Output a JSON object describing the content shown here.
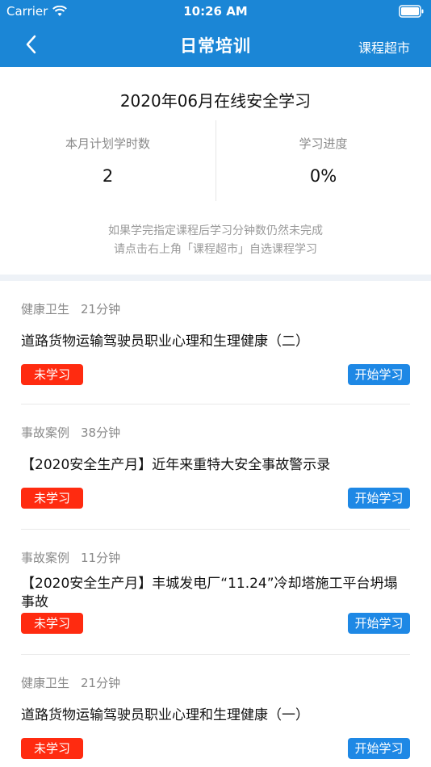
{
  "status_bar": {
    "carrier": "Carrier",
    "time": "10:26 AM"
  },
  "nav": {
    "title": "日常培训",
    "right_link": "课程超市"
  },
  "summary": {
    "plan_title": "2020年06月在线安全学习",
    "planned_hours_label": "本月计划学时数",
    "planned_hours_value": "2",
    "progress_label": "学习进度",
    "progress_value": "0%",
    "hint_line1": "如果学完指定课程后学习分钟数仍然未完成",
    "hint_line2": "请点击右上角「课程超市」自选课程学习"
  },
  "courses": [
    {
      "category": "健康卫生",
      "duration": "21分钟",
      "name": "道路货物运输驾驶员职业心理和生理健康（二）",
      "status": "未学习",
      "action": "开始学习"
    },
    {
      "category": "事故案例",
      "duration": "38分钟",
      "name": "【2020安全生产月】近年来重特大安全事故警示录",
      "status": "未学习",
      "action": "开始学习"
    },
    {
      "category": "事故案例",
      "duration": "11分钟",
      "name": "【2020安全生产月】丰城发电厂“11.24”冷却塔施工平台坍塌事故",
      "status": "未学习",
      "action": "开始学习"
    },
    {
      "category": "健康卫生",
      "duration": "21分钟",
      "name": "道路货物运输驾驶员职业心理和生理健康（一）",
      "status": "未学习",
      "action": "开始学习"
    }
  ],
  "colors": {
    "header": "#1b86d6",
    "unstudied_badge": "#ff2b10",
    "start_button": "#1e88e5"
  }
}
